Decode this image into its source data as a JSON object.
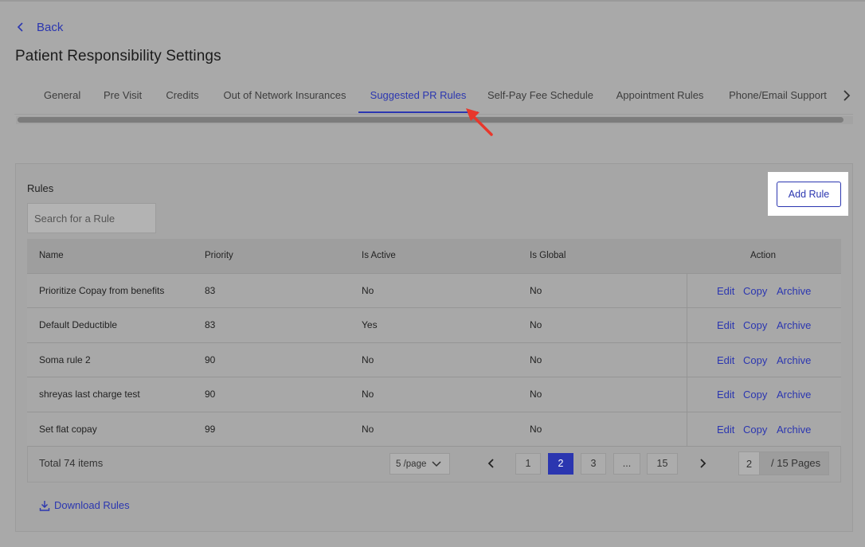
{
  "back_label": "Back",
  "page_title": "Patient Responsibility Settings",
  "tabs": [
    {
      "label": "General"
    },
    {
      "label": "Pre Visit"
    },
    {
      "label": "Credits"
    },
    {
      "label": "Out of Network Insurances"
    },
    {
      "label": "Suggested PR Rules",
      "active": true
    },
    {
      "label": "Self-Pay Fee Schedule"
    },
    {
      "label": "Appointment Rules"
    },
    {
      "label": "Phone/Email Support"
    }
  ],
  "rules_section": {
    "label": "Rules",
    "search_placeholder": "Search for a Rule",
    "add_rule_label": "Add Rule"
  },
  "table": {
    "headers": [
      "Name",
      "Priority",
      "Is Active",
      "Is Global",
      "Action"
    ],
    "rows": [
      {
        "name": "Prioritize Copay from benefits",
        "priority": "83",
        "is_active": "No",
        "is_global": "No"
      },
      {
        "name": "Default Deductible",
        "priority": "83",
        "is_active": "Yes",
        "is_global": "No"
      },
      {
        "name": "Soma rule 2",
        "priority": "90",
        "is_active": "No",
        "is_global": "No"
      },
      {
        "name": "shreyas last charge test",
        "priority": "90",
        "is_active": "No",
        "is_global": "No"
      },
      {
        "name": "Set flat copay",
        "priority": "99",
        "is_active": "No",
        "is_global": "No"
      }
    ],
    "actions": [
      "Edit",
      "Copy",
      "Archive"
    ]
  },
  "pagination": {
    "total": "Total 74 items",
    "page_size": "5 /page",
    "pages": [
      "1",
      "2",
      "3",
      "...",
      "15"
    ],
    "current": "2",
    "goto_value": "2",
    "goto_label": "/ 15 Pages"
  },
  "download_label": "Download Rules",
  "colors": {
    "accent": "#2b36b0",
    "annotation_arrow": "#e8372b"
  },
  "icons": [
    "chevron-left-icon",
    "chevron-right-icon",
    "chevron-down-icon",
    "download-icon",
    "red-arrow-annotation"
  ]
}
